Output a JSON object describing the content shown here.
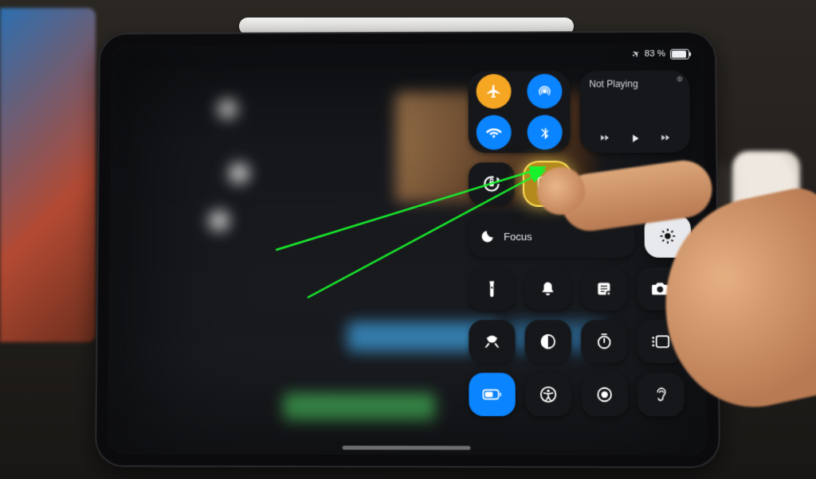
{
  "status_bar": {
    "battery_text": "83 %",
    "airplane_mode": true
  },
  "control_center": {
    "connectivity": {
      "airplane": {
        "name": "airplane-mode",
        "active": true,
        "color": "#f5a623"
      },
      "airdrop": {
        "name": "airdrop",
        "active": true,
        "color": "#0a84ff"
      },
      "wifi": {
        "name": "wifi",
        "active": true,
        "color": "#0a84ff"
      },
      "bluetooth": {
        "name": "bluetooth",
        "active": true,
        "color": "#0a84ff"
      }
    },
    "now_playing": {
      "title": "Not Playing"
    },
    "row2": {
      "orientation_lock": {
        "name": "orientation-lock"
      },
      "screen_mirroring": {
        "name": "screen-mirroring",
        "highlighted": true
      }
    },
    "row3": {
      "focus_label": "Focus",
      "brightness": {
        "name": "brightness"
      }
    },
    "grid": [
      {
        "name": "flashlight-icon"
      },
      {
        "name": "silent-mode-icon"
      },
      {
        "name": "notes-icon"
      },
      {
        "name": "camera-icon"
      },
      {
        "name": "shazam-icon"
      },
      {
        "name": "dark-mode-icon"
      },
      {
        "name": "timer-icon"
      },
      {
        "name": "stage-manager-icon"
      },
      {
        "name": "low-power-icon",
        "active": true
      },
      {
        "name": "accessibility-icon"
      },
      {
        "name": "screen-record-icon"
      },
      {
        "name": "hearing-icon"
      }
    ]
  },
  "annotation": {
    "target": "screen-mirroring",
    "color": "#18f22c"
  }
}
